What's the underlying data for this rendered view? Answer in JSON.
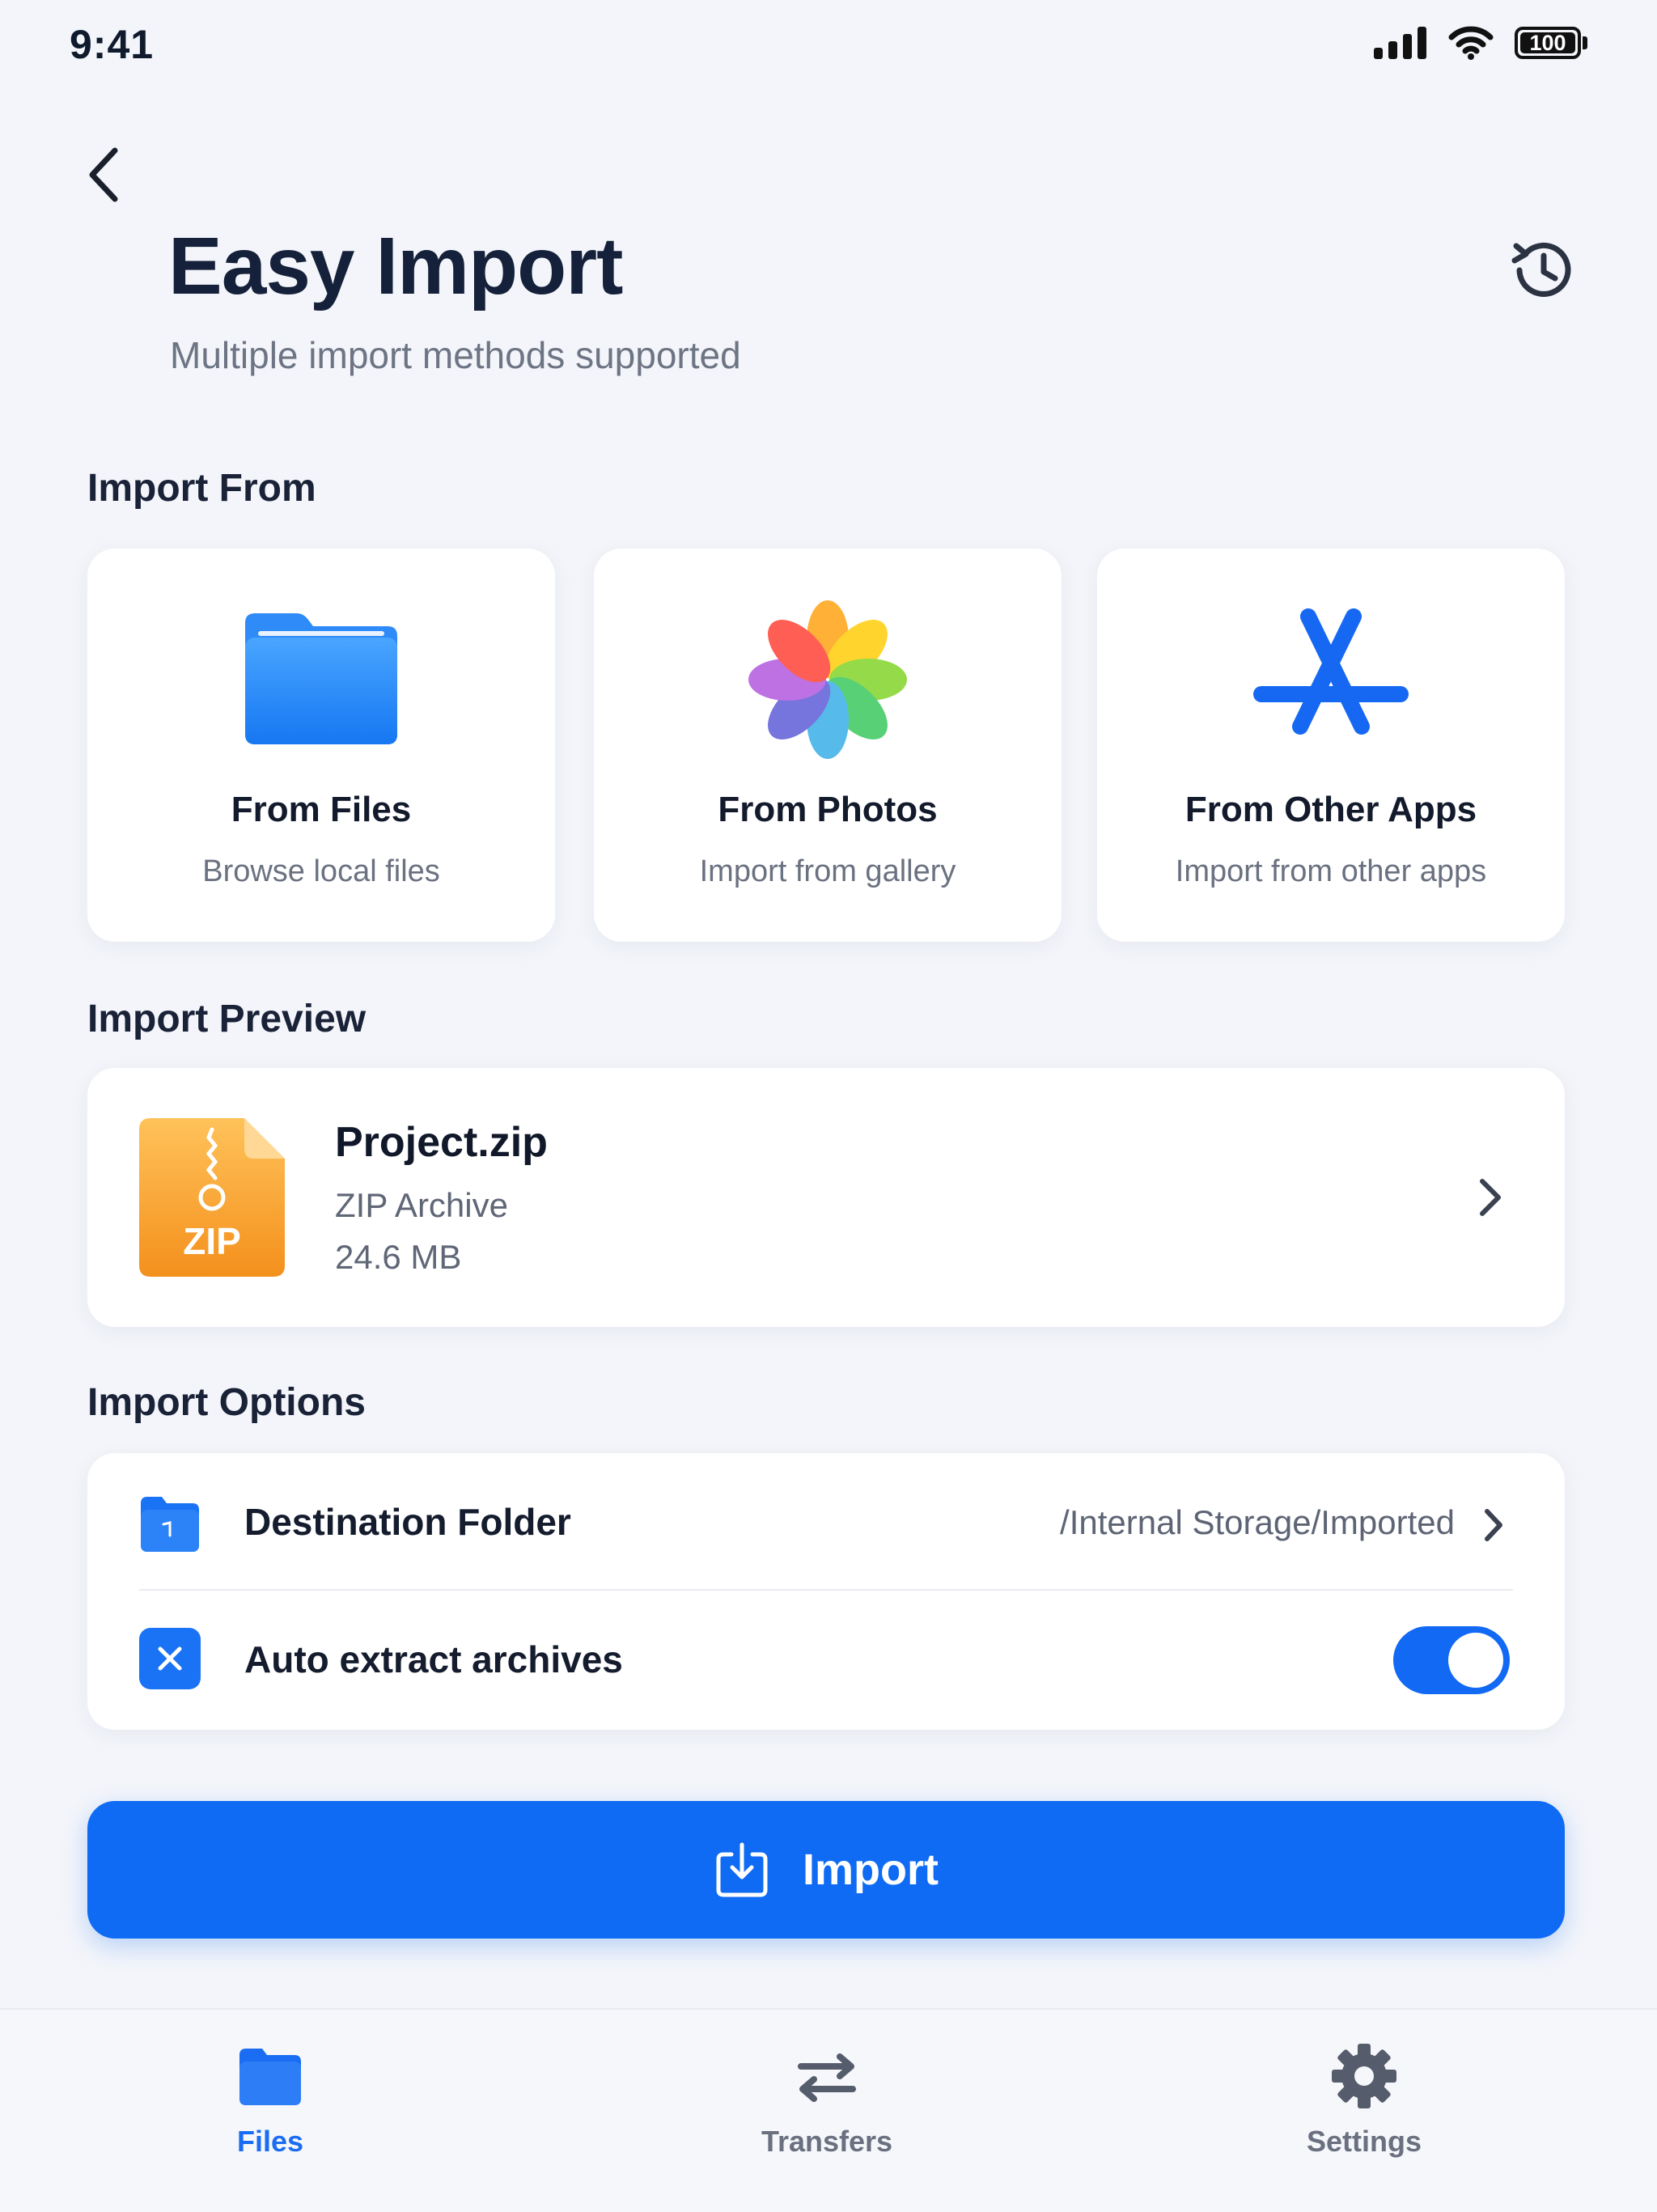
{
  "status_bar": {
    "time": "9:41",
    "battery": "100"
  },
  "header": {
    "title": "Easy Import",
    "subtitle": "Multiple import methods supported"
  },
  "sections": {
    "import_from": "Import From",
    "import_preview": "Import Preview",
    "import_options": "Import Options"
  },
  "sources": [
    {
      "title": "From Files",
      "desc": "Browse local files",
      "icon": "folder-icon"
    },
    {
      "title": "From Photos",
      "desc": "Import from gallery",
      "icon": "photos-icon"
    },
    {
      "title": "From Other Apps",
      "desc": "Import from other apps",
      "icon": "app-store-icon"
    }
  ],
  "preview": {
    "badge": "ZIP",
    "name": "Project.zip",
    "type": "ZIP Archive",
    "size": "24.6 MB"
  },
  "options": {
    "destination_label": "Destination Folder",
    "destination_value": "/Internal Storage/Imported",
    "auto_extract_label": "Auto extract archives",
    "auto_extract_on": true
  },
  "import_button": {
    "label": "Import"
  },
  "tabs": [
    {
      "label": "Files",
      "active": true
    },
    {
      "label": "Transfers",
      "active": false
    },
    {
      "label": "Settings",
      "active": false
    }
  ],
  "colors": {
    "accent": "#0F6BF4",
    "background": "#F3F5FA",
    "zip": "#F6A128"
  }
}
